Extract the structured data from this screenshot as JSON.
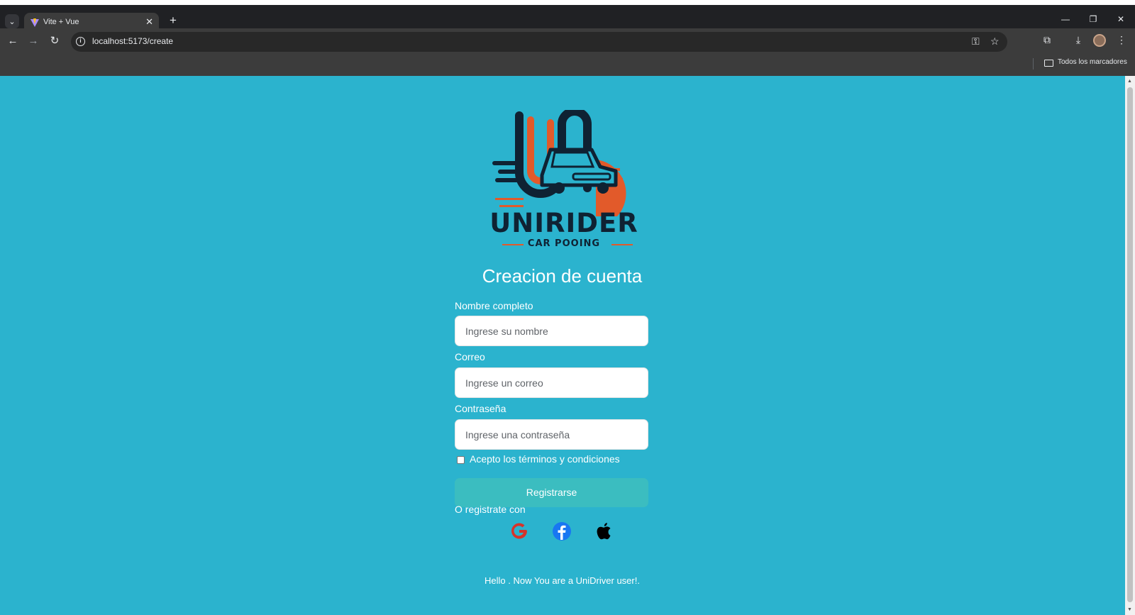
{
  "browser": {
    "tab_title": "Vite + Vue",
    "tab_close": "✕",
    "new_tab": "+",
    "url": "localhost:5173/create",
    "bookmarks_label": "Todos los marcadores",
    "icons": [
      "tab-search-icon",
      "back-icon",
      "forward-icon",
      "reload-icon",
      "site-info-icon",
      "password-key-icon",
      "bookmark-star-icon",
      "extensions-icon",
      "download-icon",
      "profile-avatar",
      "menu-icon",
      "folder-icon",
      "minimize-icon",
      "restore-icon",
      "close-window-icon"
    ]
  },
  "brand": {
    "title": "UNIRIDER",
    "subtitle": "CAR POOING",
    "colors": {
      "navy": "#0f2233",
      "orange": "#e25a2a"
    }
  },
  "form": {
    "title": "Creacion de cuenta",
    "name_label": "Nombre completo",
    "name_placeholder": "Ingrese su nombre",
    "email_label": "Correo",
    "email_placeholder": "Ingrese un correo",
    "password_label": "Contraseña",
    "password_placeholder": "Ingrese una contraseña",
    "terms_label": "Acepto los términos y condiciones",
    "terms_checked": false,
    "register_button": "Registrarse",
    "alt_label": "O registrate con",
    "social_icons": [
      "google-icon",
      "facebook-icon",
      "apple-icon"
    ]
  },
  "footer": {
    "message": "Hello . Now You are a UniDriver user!."
  },
  "colors": {
    "page_background": "#2bb3ce",
    "button_background": "#3bbdc0",
    "text": "#ffffff"
  }
}
